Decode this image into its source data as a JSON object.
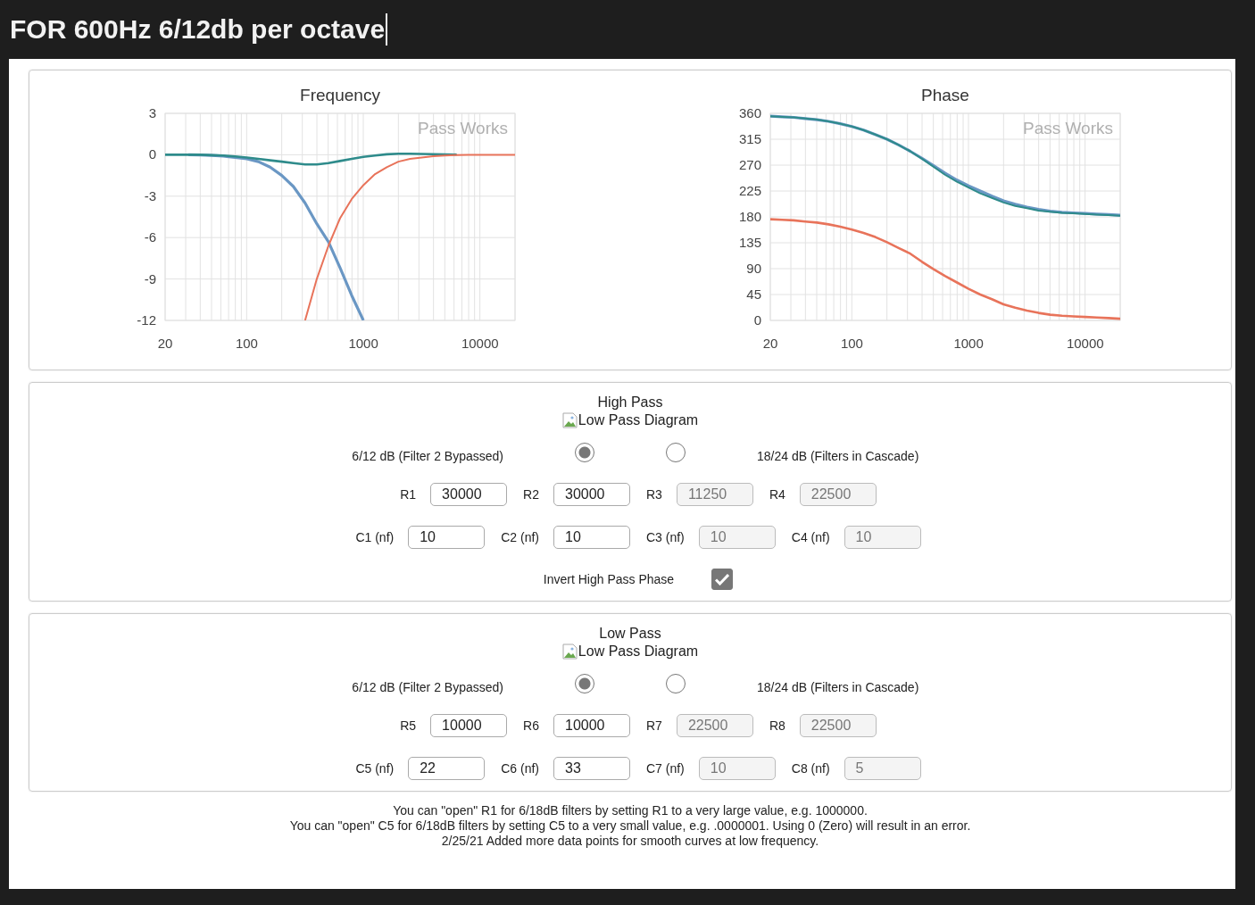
{
  "header": {
    "title": "FOR 600Hz 6/12db per octave"
  },
  "charts": [
    {
      "watermark": "Pass Works",
      "chart_data": {
        "type": "line",
        "title": "Frequency",
        "grid": true,
        "categories": [
          "20",
          null,
          null,
          null,
          null,
          null,
          null,
          "100",
          null,
          null,
          null,
          null,
          null,
          null,
          null,
          null,
          null,
          "1000",
          null,
          null,
          null,
          null,
          null,
          null,
          null,
          null,
          null,
          "10000",
          null,
          null,
          null
        ],
        "ylim": [
          -12,
          3
        ],
        "yticks": [
          3,
          0,
          -3,
          -6,
          -9,
          -12
        ],
        "series": [
          {
            "color": "#6a97c4",
            "values": [
              null,
              null,
              0,
              -0.02,
              -0.05,
              -0.1,
              -0.2,
              -0.3,
              -0.5,
              -0.9,
              -1.5,
              -2.3,
              -3.5,
              -5,
              -6.3,
              -8.2,
              -10.2,
              -12,
              null,
              null,
              null,
              null,
              null,
              null,
              null,
              null,
              null,
              null,
              null,
              null,
              null
            ]
          },
          {
            "color": "#2e8b8b",
            "values": [
              0,
              0,
              0,
              0,
              -0.03,
              -0.06,
              -0.12,
              -0.2,
              -0.3,
              -0.4,
              -0.5,
              -0.6,
              -0.7,
              -0.7,
              -0.6,
              -0.45,
              -0.3,
              -0.15,
              -0.05,
              0.03,
              0.07,
              0.08,
              0.06,
              0.04,
              0.02,
              0.01,
              null,
              null,
              null,
              null,
              null
            ]
          },
          {
            "color": "#e8735a",
            "values": [
              null,
              null,
              null,
              null,
              null,
              null,
              null,
              null,
              null,
              null,
              null,
              null,
              -12,
              -9,
              -6.6,
              -4.6,
              -3.2,
              -2.2,
              -1.4,
              -0.9,
              -0.5,
              -0.3,
              -0.2,
              -0.1,
              -0.05,
              -0.02,
              0,
              0,
              0,
              0,
              0
            ]
          }
        ]
      }
    },
    {
      "watermark": "Pass Works",
      "chart_data": {
        "type": "line",
        "title": "Phase",
        "grid": true,
        "categories": [
          "20",
          null,
          null,
          null,
          null,
          null,
          null,
          "100",
          null,
          null,
          null,
          null,
          null,
          null,
          null,
          null,
          null,
          "1000",
          null,
          null,
          null,
          null,
          null,
          null,
          null,
          null,
          null,
          "10000",
          null,
          null,
          null
        ],
        "ylim": [
          0,
          360
        ],
        "yticks": [
          360,
          315,
          270,
          225,
          180,
          135,
          90,
          45,
          0
        ],
        "series": [
          {
            "color": "#6a97c4",
            "values": [
              355,
              354,
              353,
              351,
              349,
              346,
              342,
              337,
              331,
              323,
              315,
              305,
              294,
              282,
              269,
              256,
              244,
              234,
              225,
              216,
              208,
              202,
              197,
              193,
              190,
              188,
              187,
              186,
              185,
              184,
              183
            ]
          },
          {
            "color": "#e8735a",
            "values": [
              176,
              175,
              174,
              172,
              170,
              167,
              163,
              158,
              152,
              145,
              136,
              126,
              116,
              102,
              89,
              77,
              66,
              55,
              45,
              37,
              28,
              22,
              17,
              13,
              10,
              8,
              7,
              6,
              5,
              4,
              3
            ]
          },
          {
            "color": "#2e8b8b",
            "values": [
              355,
              354,
              353,
              351,
              349,
              346,
              342,
              337,
              331,
              323,
              315,
              305,
              294,
              281,
              267,
              253,
              241,
              231,
              221,
              213,
              205,
              199,
              195,
              191,
              189,
              187,
              186,
              185,
              184,
              183,
              182
            ]
          }
        ]
      }
    }
  ],
  "filters": [
    {
      "title": "High Pass",
      "diagram_alt": "Low Pass Diagram",
      "modes": [
        {
          "label": "6/12 dB (Filter 2 Bypassed)",
          "selected": true
        },
        {
          "label": "18/24 dB (Filters in Cascade)",
          "selected": false
        }
      ],
      "resistors": [
        {
          "label": "R1",
          "value": "30000",
          "disabled": false
        },
        {
          "label": "R2",
          "value": "30000",
          "disabled": false
        },
        {
          "label": "R3",
          "value": "11250",
          "disabled": true
        },
        {
          "label": "R4",
          "value": "22500",
          "disabled": true
        }
      ],
      "capacitors": [
        {
          "label": "C1 (nf)",
          "value": "10",
          "disabled": false
        },
        {
          "label": "C2 (nf)",
          "value": "10",
          "disabled": false
        },
        {
          "label": "C3 (nf)",
          "value": "10",
          "disabled": true
        },
        {
          "label": "C4 (nf)",
          "value": "10",
          "disabled": true
        }
      ],
      "invert": {
        "label": "Invert High Pass Phase",
        "checked": true
      }
    },
    {
      "title": "Low Pass",
      "diagram_alt": "Low Pass Diagram",
      "modes": [
        {
          "label": "6/12 dB (Filter 2 Bypassed)",
          "selected": true
        },
        {
          "label": "18/24 dB (Filters in Cascade)",
          "selected": false
        }
      ],
      "resistors": [
        {
          "label": "R5",
          "value": "10000",
          "disabled": false
        },
        {
          "label": "R6",
          "value": "10000",
          "disabled": false
        },
        {
          "label": "R7",
          "value": "22500",
          "disabled": true
        },
        {
          "label": "R8",
          "value": "22500",
          "disabled": true
        }
      ],
      "capacitors": [
        {
          "label": "C5 (nf)",
          "value": "22",
          "disabled": false
        },
        {
          "label": "C6 (nf)",
          "value": "33",
          "disabled": false
        },
        {
          "label": "C7 (nf)",
          "value": "10",
          "disabled": true
        },
        {
          "label": "C8 (nf)",
          "value": "5",
          "disabled": true
        }
      ]
    }
  ],
  "notes": [
    "You can \"open\" R1 for 6/18dB filters by setting R1 to a very large value, e.g. 1000000.",
    "You can \"open\" C5 for 6/18dB filters by setting C5 to a very small value, e.g. .0000001. Using 0 (Zero) will result in an error.",
    "2/25/21 Added more data points for smooth curves at low frequency."
  ]
}
